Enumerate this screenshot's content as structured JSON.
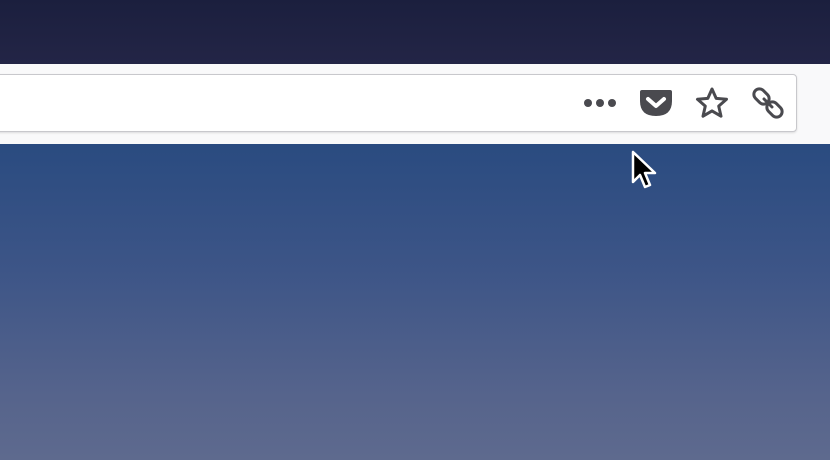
{
  "window": {
    "titlebar_color": "#1f2242"
  },
  "toolbar": {
    "background": "#f9f9fa"
  },
  "urlbar": {
    "value": "",
    "page_actions": [
      {
        "name": "page-actions-menu-button",
        "icon": "more-horizontal-icon"
      },
      {
        "name": "save-to-pocket-button",
        "icon": "pocket-icon"
      },
      {
        "name": "bookmark-star-button",
        "icon": "star-icon"
      },
      {
        "name": "reader-link-button",
        "icon": "link-icon"
      }
    ],
    "icon_color": "#4a4a4f"
  },
  "content": {
    "gradient_top": "#2a4b80",
    "gradient_bottom": "#5e6a8e"
  }
}
